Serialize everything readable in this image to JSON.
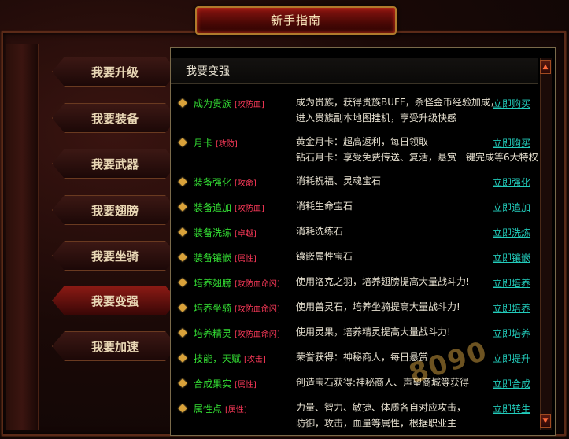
{
  "header": {
    "title": "新手指南"
  },
  "nav": [
    {
      "label": "我要升级",
      "active": false
    },
    {
      "label": "我要装备",
      "active": false
    },
    {
      "label": "我要武器",
      "active": false
    },
    {
      "label": "我要翅膀",
      "active": false
    },
    {
      "label": "我要坐骑",
      "active": false
    },
    {
      "label": "我要变强",
      "active": true
    },
    {
      "label": "我要加速",
      "active": false
    }
  ],
  "panel": {
    "title": "我要变强",
    "rows": [
      {
        "name": "成为贵族",
        "tag": "[攻防血]",
        "desc": [
          "成为贵族，获得贵族BUFF，杀怪金币经验加成，",
          "进入贵族副本地图挂机，享受升级快感"
        ],
        "action": "立即购买"
      },
      {
        "name": "月卡",
        "tag": "[攻防]",
        "desc": [
          "黄金月卡：超高返利，每日领取",
          "钻石月卡：享受免费传送、复活，悬赏一键完成等6大特权"
        ],
        "action": "立即购买"
      },
      {
        "name": "装备强化",
        "tag": "[攻命]",
        "desc": [
          "消耗祝福、灵魂宝石"
        ],
        "action": "立即强化"
      },
      {
        "name": "装备追加",
        "tag": "[攻防血]",
        "desc": [
          "消耗生命宝石"
        ],
        "action": "立即追加"
      },
      {
        "name": "装备洗练",
        "tag": "[卓越]",
        "desc": [
          "消耗洗练石"
        ],
        "action": "立即洗炼"
      },
      {
        "name": "装备镶嵌",
        "tag": "[属性]",
        "desc": [
          "镶嵌属性宝石"
        ],
        "action": "立即镶嵌"
      },
      {
        "name": "培养翅膀",
        "tag": "[攻防血命闪]",
        "desc": [
          "使用洛克之羽，培养翅膀提高大量战斗力!"
        ],
        "action": "立即培养"
      },
      {
        "name": "培养坐骑",
        "tag": "[攻防血命闪]",
        "desc": [
          "使用兽灵石，培养坐骑提高大量战斗力!"
        ],
        "action": "立即培养"
      },
      {
        "name": "培养精灵",
        "tag": "[攻防血命闪]",
        "desc": [
          "使用灵果，培养精灵提高大量战斗力!"
        ],
        "action": "立即培养"
      },
      {
        "name": "技能，天赋",
        "tag": "[攻击]",
        "desc": [
          "荣誉获得：神秘商人，每日悬赏"
        ],
        "action": "立即提升"
      },
      {
        "name": "合成果实",
        "tag": "[属性]",
        "desc": [
          "创造宝石获得:神秘商人、声望商城等获得"
        ],
        "action": "立即合成"
      },
      {
        "name": "属性点",
        "tag": "[属性]",
        "desc": [
          "力量、智力、敏捷、体质各自对应攻击，",
          "防御，攻击，血量等属性，根据职业主"
        ],
        "action": "立即转生"
      }
    ]
  },
  "watermark": {
    "text": "8090"
  },
  "colors": {
    "name_green": "#33dd33",
    "tag_red": "#ff3a5a",
    "action_teal": "#22ccbb"
  }
}
